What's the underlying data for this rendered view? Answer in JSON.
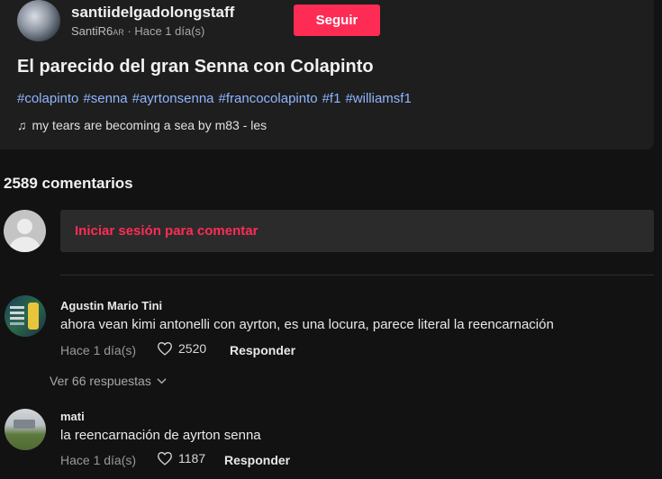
{
  "post": {
    "username": "santiidelgadolongstaff",
    "nickname": "SantiR6",
    "nickname_suffix": "AR",
    "time": "Hace 1 día(s)",
    "follow_label": "Seguir",
    "title": "El parecido del gran Senna con Colapinto",
    "hashtags": [
      "#colapinto",
      "#senna",
      "#ayrtonsenna",
      "#francocolapinto",
      "#f1",
      "#williamsf1"
    ],
    "music": "my tears are becoming a sea by m83 - les"
  },
  "comments_section": {
    "count_label": "2589 comentarios",
    "login_prompt": "Iniciar sesión para comentar"
  },
  "comments": [
    {
      "author": "Agustin Mario Tini",
      "text": "ahora vean kimi antonelli con ayrton, es una locura, parece literal la reencarnación",
      "time": "Hace 1 día(s)",
      "likes": "2520",
      "reply_label": "Responder",
      "view_replies": "Ver 66 respuestas"
    },
    {
      "author": "mati",
      "text": "la reencarnación de ayrton senna",
      "time": "Hace 1 día(s)",
      "likes": "1187",
      "reply_label": "Responder"
    }
  ],
  "colors": {
    "accent": "#fe2c55",
    "hashtag": "#8fb5ff",
    "background": "#121212",
    "card": "#1e1e1e"
  },
  "icons": {
    "music": "music-note-icon",
    "like": "heart-outline-icon",
    "expand": "chevron-down-icon",
    "guest": "user-placeholder-icon"
  }
}
